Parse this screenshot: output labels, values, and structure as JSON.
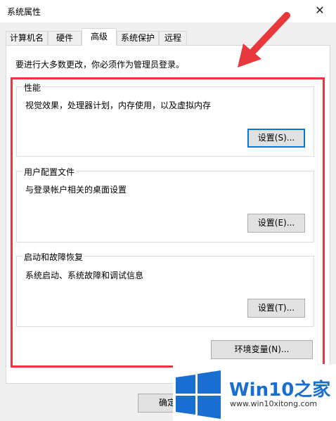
{
  "window": {
    "title": "系统属性",
    "close_glyph": "✕"
  },
  "tabs": [
    {
      "label": "计算机名",
      "active": false
    },
    {
      "label": "硬件",
      "active": false
    },
    {
      "label": "高级",
      "active": true
    },
    {
      "label": "系统保护",
      "active": false
    },
    {
      "label": "远程",
      "active": false
    }
  ],
  "notice": "要进行大多数更改，你必须作为管理员登录。",
  "groups": {
    "performance": {
      "title": "性能",
      "desc": "视觉效果，处理器计划，内存使用，以及虚拟内存",
      "button": "设置(S)..."
    },
    "profiles": {
      "title": "用户配置文件",
      "desc": "与登录帐户相关的桌面设置",
      "button": "设置(E)..."
    },
    "startup": {
      "title": "启动和故障恢复",
      "desc": "系统启动、系统故障和调试信息",
      "button": "设置(T)..."
    }
  },
  "env_button": "环境变量(N)...",
  "ok_button": "确定",
  "watermark": {
    "brand": "Win10",
    "brand_zh": "之家",
    "url": "www.win10xitong.com"
  },
  "colors": {
    "annotation": "#e8383d",
    "focus": "#0078d7",
    "logo_blue": "#1a6ed1"
  }
}
